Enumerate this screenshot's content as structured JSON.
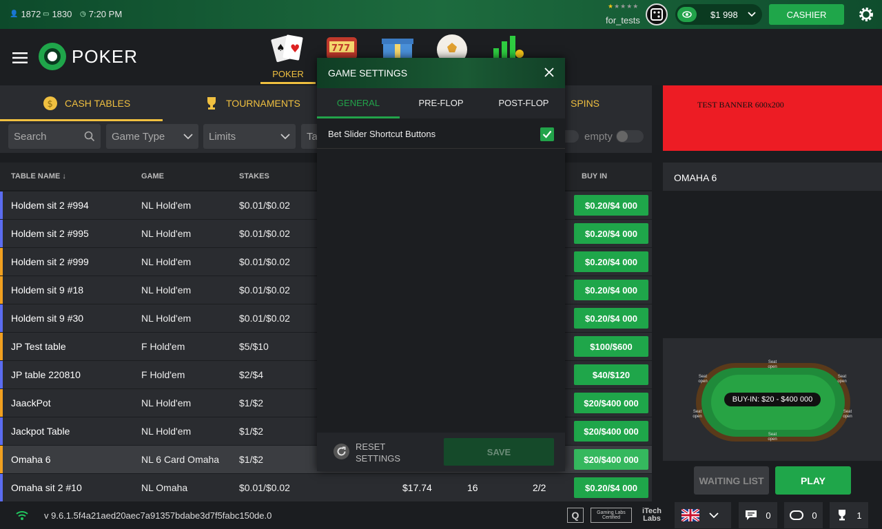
{
  "topbar": {
    "players_online": "1872",
    "tables_online": "1830",
    "time": "7:20 PM",
    "username": "for_tests",
    "balance": "$1 998",
    "cashier_label": "CASHIER"
  },
  "header": {
    "logo_text": "POKER",
    "nav": [
      {
        "label": "POKER",
        "icon": "cards-icon"
      },
      {
        "label": "",
        "icon": "slots-icon"
      },
      {
        "label": "",
        "icon": "gift-icon"
      },
      {
        "label": "",
        "icon": "ball-icon"
      },
      {
        "label": "",
        "icon": "chart-coins-icon"
      }
    ]
  },
  "tabs": {
    "cash": "CASH TABLES",
    "tournaments": "TOURNAMENTS",
    "spins": "SPINS"
  },
  "filters": {
    "search_placeholder": "Search",
    "game_type": "Game Type",
    "limits": "Limits",
    "table_size": "Ta",
    "empty_label": "empty"
  },
  "columns": {
    "table_name": "TABLE NAME ↓",
    "game": "GAME",
    "stakes": "STAKES",
    "buy_in": "BUY IN"
  },
  "rows": [
    {
      "name": "Holdem sit 2 #994",
      "game": "NL Hold'em",
      "stakes": "$0.01/$0.02",
      "avg_pot": "",
      "players": "",
      "seats": "",
      "buy_in": "$0.20/$4 000",
      "accent": "#5b6cf0"
    },
    {
      "name": "Holdem sit 2 #995",
      "game": "NL Hold'em",
      "stakes": "$0.01/$0.02",
      "avg_pot": "",
      "players": "",
      "seats": "",
      "buy_in": "$0.20/$4 000",
      "accent": "#5b6cf0"
    },
    {
      "name": "Holdem sit 2 #999",
      "game": "NL Hold'em",
      "stakes": "$0.01/$0.02",
      "avg_pot": "",
      "players": "",
      "seats": "",
      "buy_in": "$0.20/$4 000",
      "accent": "#f0a020"
    },
    {
      "name": "Holdem sit 9 #18",
      "game": "NL Hold'em",
      "stakes": "$0.01/$0.02",
      "avg_pot": "",
      "players": "",
      "seats": "",
      "buy_in": "$0.20/$4 000",
      "accent": "#f0a020"
    },
    {
      "name": "Holdem sit 9 #30",
      "game": "NL Hold'em",
      "stakes": "$0.01/$0.02",
      "avg_pot": "",
      "players": "",
      "seats": "",
      "buy_in": "$0.20/$4 000",
      "accent": "#5b6cf0"
    },
    {
      "name": "JP Test table",
      "game": "F Hold'em",
      "stakes": "$5/$10",
      "avg_pot": "",
      "players": "",
      "seats": "",
      "buy_in": "$100/$600",
      "accent": "#f0a020"
    },
    {
      "name": "JP table 220810",
      "game": "F Hold'em",
      "stakes": "$2/$4",
      "avg_pot": "",
      "players": "",
      "seats": "",
      "buy_in": "$40/$120",
      "accent": "#5b6cf0"
    },
    {
      "name": "JaackPot",
      "game": "NL Hold'em",
      "stakes": "$1/$2",
      "avg_pot": "",
      "players": "",
      "seats": "",
      "buy_in": "$20/$400 000",
      "accent": "#f0a020"
    },
    {
      "name": "Jackpot Table",
      "game": "NL Hold'em",
      "stakes": "$1/$2",
      "avg_pot": "",
      "players": "",
      "seats": "",
      "buy_in": "$20/$400 000",
      "accent": "#5b6cf0"
    },
    {
      "name": "Omaha 6",
      "game": "NL 6 Card Omaha",
      "stakes": "$1/$2",
      "avg_pot": "",
      "players": "",
      "seats": "",
      "buy_in": "$20/$400 000",
      "accent": "#f0a020",
      "selected": true
    },
    {
      "name": "Omaha sit 2 #10",
      "game": "NL Omaha",
      "stakes": "$0.01/$0.02",
      "avg_pot": "$17.74",
      "players": "16",
      "seats": "2/2",
      "buy_in": "$0.20/$4 000",
      "accent": "#5b6cf0"
    }
  ],
  "right_panel": {
    "banner_text": "TEST BANNER 600x200",
    "selected_table": "OMAHA 6",
    "buyin_label": "BUY-IN: $20 - $400 000",
    "seat_label_1": "Seat",
    "seat_label_2": "open",
    "waiting_list": "WAITING LIST",
    "play": "PLAY"
  },
  "modal": {
    "title": "GAME SETTINGS",
    "tabs": [
      "GENERAL",
      "PRE-FLOP",
      "POST-FLOP"
    ],
    "setting_label": "Bet Slider Shortcut Buttons",
    "setting_checked": true,
    "reset_line1": "RESET",
    "reset_line2": "SETTINGS",
    "save": "SAVE"
  },
  "footer": {
    "version": "v 9.6.1.5f4a21aed20aec7a91357bdabe3d7f5fabc150de.0",
    "cert1": "Q",
    "cert2": "Gaming Labs Certified",
    "cert3": "iTech Labs",
    "chat_count": "0",
    "tables_count": "0",
    "trophy_count": "1"
  },
  "colors": {
    "accent_green": "#1fa64a",
    "gold": "#f0c040",
    "banner_red": "#ed1c24"
  }
}
